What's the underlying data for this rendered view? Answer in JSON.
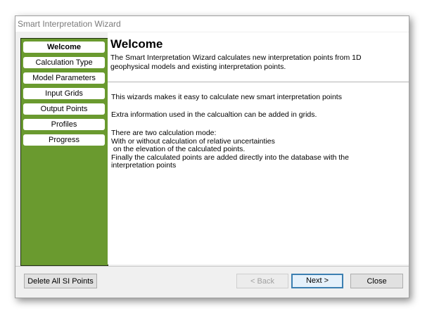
{
  "window": {
    "title": "Smart Interpretation Wizard"
  },
  "sidebar": {
    "items": [
      {
        "label": "Welcome",
        "active": true
      },
      {
        "label": "Calculation Type",
        "active": false
      },
      {
        "label": "Model Parameters",
        "active": false
      },
      {
        "label": "Input Grids",
        "active": false
      },
      {
        "label": "Output Points",
        "active": false
      },
      {
        "label": "Profiles",
        "active": false
      },
      {
        "label": "Progress",
        "active": false
      }
    ]
  },
  "header": {
    "title": "Welcome",
    "description": "The Smart Interpretation Wizard calculates new interpretation points from 1D geophysical models and existing interpretation points."
  },
  "content": {
    "paragraph1": "This wizards makes it easy to calculate new smart interpretation points",
    "paragraph2": "Extra information used in the calcualtion can be added in grids.",
    "paragraph3": "There are two calculation mode:\nWith or without calculation of relative uncertainties\n on the elevation of the calculated points.\nFinally the calculated points are added directly into the database with the\ninterpretation points"
  },
  "footer": {
    "delete_label": "Delete All SI Points",
    "back_label": "< Back",
    "next_label": "Next >",
    "close_label": "Close"
  },
  "colors": {
    "sidebar_bg": "#6a9a2f",
    "default_button_border": "#3c7fb1"
  }
}
